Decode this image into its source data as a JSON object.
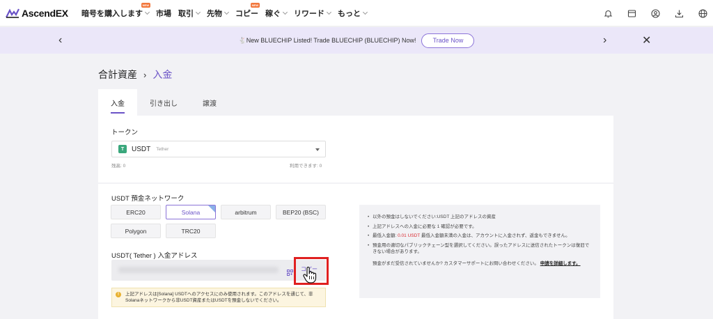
{
  "brand": {
    "name": "AscendEX",
    "accent": "#6a52c7"
  },
  "nav": {
    "items": [
      {
        "label": "暗号を購入します",
        "badge": "NEW",
        "dropdown": true
      },
      {
        "label": "市場",
        "badge": "",
        "dropdown": false
      },
      {
        "label": "取引",
        "badge": "",
        "dropdown": true
      },
      {
        "label": "先物",
        "badge": "",
        "dropdown": true
      },
      {
        "label": "コピー",
        "badge": "NEW",
        "dropdown": false
      },
      {
        "label": "稼ぐ",
        "badge": "",
        "dropdown": true
      },
      {
        "label": "リワード",
        "badge": "",
        "dropdown": true
      },
      {
        "label": "もっと",
        "badge": "",
        "dropdown": true
      }
    ],
    "right_icons": [
      "bell-icon",
      "wallet-icon",
      "account-icon",
      "download-icon",
      "globe-icon"
    ]
  },
  "banner": {
    "emoji": "🐇",
    "text": "New BLUECHIP Listed! Trade BLUECHIP (BLUECHIP) Now!",
    "button": "Trade Now"
  },
  "breadcrumb": {
    "root": "合計資産",
    "separator": "›",
    "current": "入金"
  },
  "tabs": [
    {
      "label": "入金",
      "active": true
    },
    {
      "label": "引き出し",
      "active": false
    },
    {
      "label": "譲渡",
      "active": false
    }
  ],
  "token": {
    "label": "トークン",
    "icon_letter": "T",
    "symbol": "USDT",
    "name": "Tether",
    "balance": "残高: 0",
    "available": "利用できます: 0"
  },
  "network": {
    "label": "USDT 預金ネットワーク",
    "options": [
      {
        "label": "ERC20",
        "selected": false
      },
      {
        "label": "Solana",
        "selected": true
      },
      {
        "label": "arbitrum",
        "selected": false
      },
      {
        "label": "BEP20 (BSC)",
        "selected": false
      },
      {
        "label": "Polygon",
        "selected": false
      },
      {
        "label": "TRC20",
        "selected": false
      }
    ]
  },
  "address": {
    "label": "USDT( Tether ) 入金アドレス",
    "copy": "コピー"
  },
  "warning": "上記アドレスは[Solana] USDTへのアクセスにのみ使用されます。このアドレスを通じて、非Solanaネットワークから非USDT資産またはUSDTを預金しないでください。",
  "notes": {
    "items": [
      {
        "text": "以外の預金はしないでください:USDT 上記のアドレスの資産",
        "amount": ""
      },
      {
        "text": "上記アドレスへの入金に必要な 1 確認が必要です。",
        "amount": ""
      },
      {
        "pre": "最低入金額:",
        "amount": "0.01 USDT",
        "post": "最低入金額未満の入金は、アカウントに入金されず、返金もできません。"
      },
      {
        "text": "預金用の適切なパブリックチェーン型を選択してください。誤ったアドレスに送信されたトークンは復旧できない場合があります。",
        "amount": ""
      }
    ],
    "help_text": "預金がまだ受信されていませんか? カスタマーサポートにお問い合わせください。",
    "help_link": "申請を詳細します。"
  }
}
